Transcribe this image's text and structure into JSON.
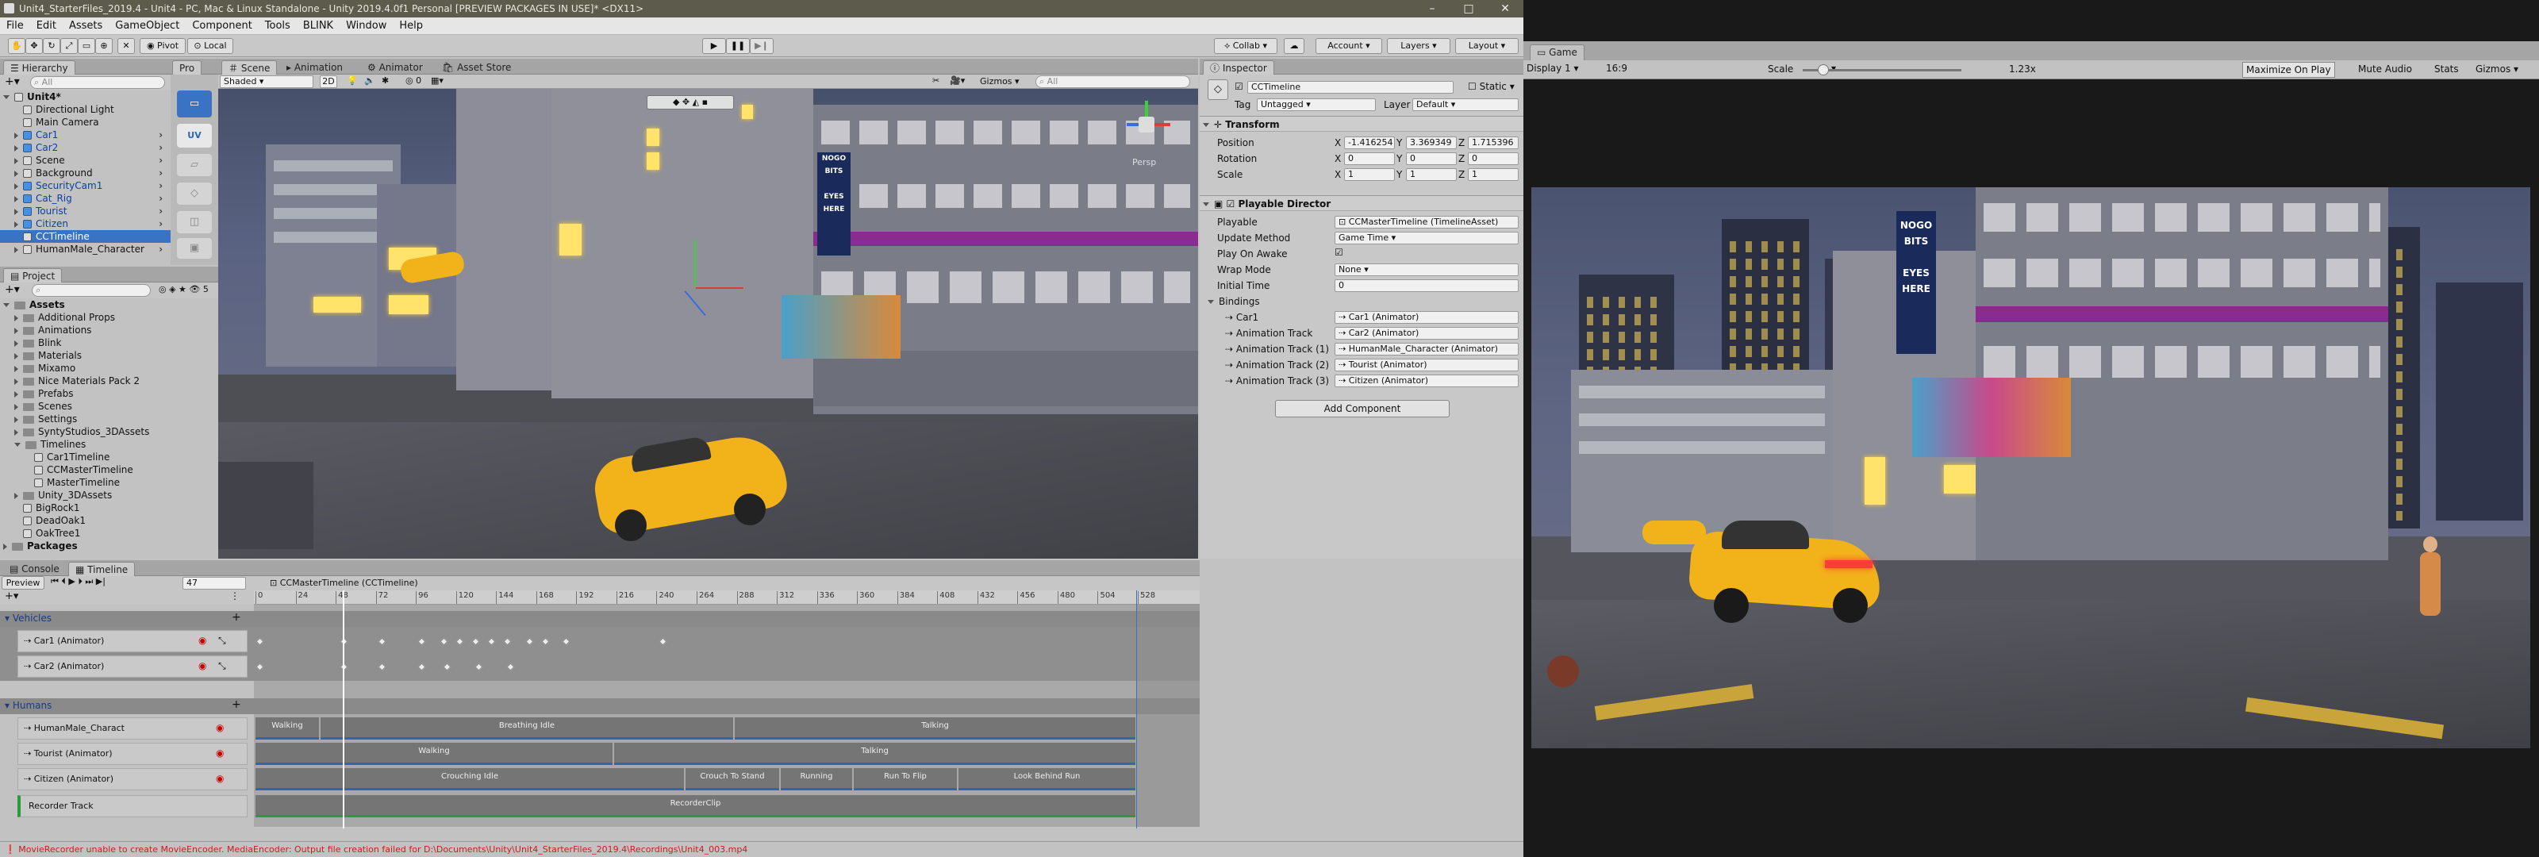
{
  "window": {
    "title": "Unit4_StarterFiles_2019.4 - Unit4 - PC, Mac & Linux Standalone - Unity 2019.4.0f1 Personal [PREVIEW PACKAGES IN USE]* <DX11>"
  },
  "menu": [
    "File",
    "Edit",
    "Assets",
    "GameObject",
    "Component",
    "Tools",
    "BLINK",
    "Window",
    "Help"
  ],
  "toolbar": {
    "pivot": "Pivot",
    "local": "Local",
    "collab": "Collab",
    "account": "Account",
    "layers": "Layers",
    "layout": "Layout"
  },
  "hierarchy": {
    "tab": "Hierarchy",
    "search_placeholder": "All",
    "items": [
      {
        "label": "Unit4*",
        "indent": 0,
        "type": "scene",
        "expanded": true
      },
      {
        "label": "Directional Light",
        "indent": 1,
        "type": "go"
      },
      {
        "label": "Main Camera",
        "indent": 1,
        "type": "go"
      },
      {
        "label": "Car1",
        "indent": 1,
        "type": "prefab",
        "arrow": true
      },
      {
        "label": "Car2",
        "indent": 1,
        "type": "prefab",
        "arrow": true
      },
      {
        "label": "Scene",
        "indent": 1,
        "type": "go",
        "arrow": true
      },
      {
        "label": "Background",
        "indent": 1,
        "type": "go",
        "arrow": true
      },
      {
        "label": "SecurityCam1",
        "indent": 1,
        "type": "prefab",
        "arrow": true
      },
      {
        "label": "Cat_Rig",
        "indent": 1,
        "type": "prefab",
        "arrow": true
      },
      {
        "label": "Tourist",
        "indent": 1,
        "type": "prefab",
        "arrow": true
      },
      {
        "label": "Citizen",
        "indent": 1,
        "type": "prefab",
        "arrow": true
      },
      {
        "label": "CCTimeline",
        "indent": 1,
        "type": "go",
        "selected": true
      },
      {
        "label": "HumanMale_Character",
        "indent": 1,
        "type": "go",
        "arrow": true
      }
    ]
  },
  "tools_panel": {
    "tab": "Pro"
  },
  "scene": {
    "tabs": [
      "Scene",
      "Animation",
      "Animator",
      "Asset Store"
    ],
    "shading": "Shaded",
    "mode_2d": "2D",
    "gizmos": "Gizmos",
    "search_placeholder": "All",
    "persp": "Persp",
    "counter": "0"
  },
  "project": {
    "tab": "Project",
    "count": "5",
    "items": [
      {
        "label": "Assets",
        "indent": 0,
        "folder": true,
        "bold": true,
        "expanded": true
      },
      {
        "label": "Additional Props",
        "indent": 1,
        "folder": true
      },
      {
        "label": "Animations",
        "indent": 1,
        "folder": true
      },
      {
        "label": "Blink",
        "indent": 1,
        "folder": true
      },
      {
        "label": "Materials",
        "indent": 1,
        "folder": true
      },
      {
        "label": "Mixamo",
        "indent": 1,
        "folder": true
      },
      {
        "label": "Nice Materials Pack 2",
        "indent": 1,
        "folder": true
      },
      {
        "label": "Prefabs",
        "indent": 1,
        "folder": true
      },
      {
        "label": "Scenes",
        "indent": 1,
        "folder": true
      },
      {
        "label": "Settings",
        "indent": 1,
        "folder": true
      },
      {
        "label": "SyntyStudios_3DAssets",
        "indent": 1,
        "folder": true
      },
      {
        "label": "Timelines",
        "indent": 1,
        "folder": true,
        "expanded": true
      },
      {
        "label": "Car1Timeline",
        "indent": 2,
        "folder": false
      },
      {
        "label": "CCMasterTimeline",
        "indent": 2,
        "folder": false
      },
      {
        "label": "MasterTimeline",
        "indent": 2,
        "folder": false
      },
      {
        "label": "Unity_3DAssets",
        "indent": 1,
        "folder": true
      },
      {
        "label": "BigRock1",
        "indent": 1,
        "folder": false
      },
      {
        "label": "DeadOak1",
        "indent": 1,
        "folder": false
      },
      {
        "label": "OakTree1",
        "indent": 1,
        "folder": false
      },
      {
        "label": "Packages",
        "indent": 0,
        "folder": true,
        "bold": true
      }
    ]
  },
  "inspector": {
    "tab": "Inspector",
    "object_name": "CCTimeline",
    "static_label": "Static",
    "tag_label": "Tag",
    "tag_value": "Untagged",
    "layer_label": "Layer",
    "layer_value": "Default",
    "transform": {
      "title": "Transform",
      "position_label": "Position",
      "rotation_label": "Rotation",
      "scale_label": "Scale",
      "position": [
        "-1.416254",
        "3.369349",
        "1.715396"
      ],
      "rotation": [
        "0",
        "0",
        "0"
      ],
      "scale": [
        "1",
        "1",
        "1"
      ]
    },
    "director": {
      "title": "Playable Director",
      "playable_label": "Playable",
      "playable_value": "CCMasterTimeline (TimelineAsset)",
      "update_label": "Update Method",
      "update_value": "Game Time",
      "awake_label": "Play On Awake",
      "wrap_label": "Wrap Mode",
      "wrap_value": "None",
      "initial_label": "Initial Time",
      "initial_value": "0",
      "bindings_label": "Bindings",
      "bindings": [
        {
          "label": "Car1",
          "value": "Car1 (Animator)"
        },
        {
          "label": "Animation Track",
          "value": "Car2 (Animator)"
        },
        {
          "label": "Animation Track (1)",
          "value": "HumanMale_Character (Animator)"
        },
        {
          "label": "Animation Track (2)",
          "value": "Tourist (Animator)"
        },
        {
          "label": "Animation Track (3)",
          "value": "Citizen (Animator)"
        }
      ]
    },
    "add_component": "Add Component"
  },
  "timeline": {
    "tabs": [
      "Console",
      "Timeline"
    ],
    "preview": "Preview",
    "frame": "47",
    "asset": "CCMasterTimeline (CCTimeline)",
    "ruler": [
      "0",
      "24",
      "48",
      "72",
      "96",
      "120",
      "144",
      "168",
      "192",
      "216",
      "240",
      "264",
      "288",
      "312",
      "336",
      "360",
      "384",
      "408",
      "432",
      "456",
      "480",
      "504",
      "528"
    ],
    "groups": [
      {
        "name": "Vehicles",
        "tracks": [
          {
            "name": "Car1 (Animator)"
          },
          {
            "name": "Car2 (Animator)"
          }
        ]
      },
      {
        "name": "Humans",
        "tracks": [
          {
            "name": "HumanMale_Charact",
            "clips": [
              "Walking",
              "Breathing Idle",
              "Talking"
            ]
          },
          {
            "name": "Tourist (Animator)",
            "clips": [
              "Walking",
              "Talking"
            ]
          },
          {
            "name": "Citizen (Animator)",
            "clips": [
              "Crouching Idle",
              "Crouch To Stand",
              "Running",
              "Run To Flip",
              "Look Behind Run"
            ]
          }
        ]
      }
    ],
    "recorder_track": "Recorder Track",
    "recorder_clip": "RecorderClip"
  },
  "status": {
    "message": "MovieRecorder unable to create MovieEncoder. MediaEncoder: Output file creation failed for D:\\Documents\\Unity\\Unit4_StarterFiles_2019.4\\Recordings\\Unit4_003.mp4",
    "color": "#c81e1e"
  },
  "game": {
    "tab": "Game",
    "display": "Display 1",
    "aspect": "16:9",
    "scale_label": "Scale",
    "scale_value": "1.23x",
    "maximize": "Maximize On Play",
    "mute": "Mute Audio",
    "stats": "Stats",
    "gizmos": "Gizmos"
  },
  "colors": {
    "accent": "#2d66b3",
    "selection": "#3a72c4",
    "taxi": "#f2b21a"
  }
}
